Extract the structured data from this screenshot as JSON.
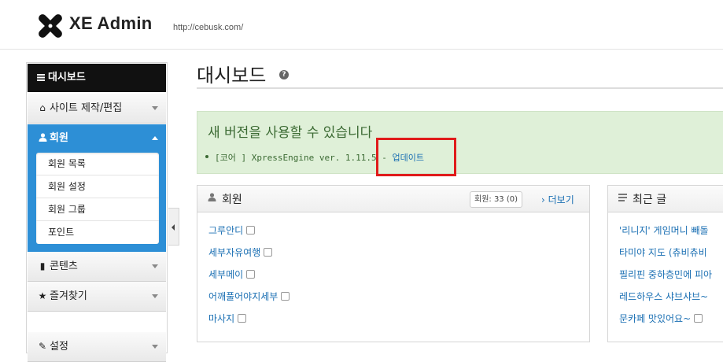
{
  "header": {
    "brand": "XE Admin",
    "url": "http://cebusk.com/"
  },
  "sidebar": {
    "dashboard": "대시보드",
    "items": [
      {
        "label": "사이트 제작/편집",
        "icon": "home-icon"
      },
      {
        "label": "회원",
        "icon": "user-icon"
      },
      {
        "label": "콘텐츠",
        "icon": "book-icon"
      },
      {
        "label": "즐겨찾기",
        "icon": "star-icon"
      },
      {
        "label": "설정",
        "icon": "wrench-icon"
      }
    ],
    "submenu": [
      "회원 목록",
      "회원 설정",
      "회원 그룹",
      "포인트"
    ]
  },
  "main": {
    "title": "대시보드",
    "alert": {
      "title": "새 버전을 사용할 수 있습니다",
      "item": "[코어 ] XpressEngine ver. 1.11.5 -",
      "link": "업데이트"
    },
    "members": {
      "title": "회원",
      "count": "회원: 33 (0)",
      "more": "› 더보기",
      "list": [
        "그루안디",
        "세부자유여행",
        "세부메이",
        "어깨풀어야지세부",
        "마사지"
      ]
    },
    "recent": {
      "title": "최근 글",
      "list": [
        "'리니지' 게임머니 빼돌",
        "타미야 지도 (츄비츄비",
        "필리핀 중하층민에 피아",
        "레드하우스 샤브샤브~",
        "문카페 맛있어요~"
      ]
    }
  }
}
